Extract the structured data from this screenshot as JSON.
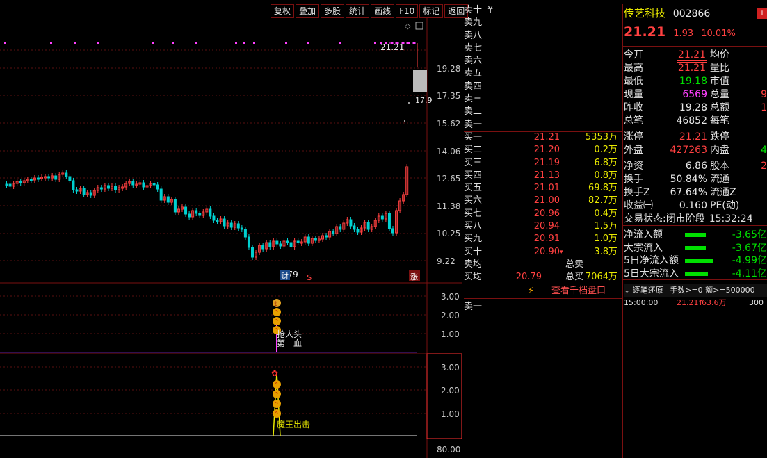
{
  "toolbar": [
    "复权",
    "叠加",
    "多股",
    "统计",
    "画线",
    "F10",
    "标记",
    "返回"
  ],
  "main_chart": {
    "price_labels": [
      "19.28",
      "17.35",
      "15.62",
      "14.06",
      "12.65",
      "11.38",
      "10.25",
      "9.22"
    ],
    "last_price_tag": "21.21",
    "cut_label": "17.9",
    "low_label": "8.79",
    "cai_badge": "财",
    "dollar_badge": "$",
    "zhang_badge": "涨"
  },
  "ind1": {
    "scale": [
      "3.00",
      "2.00",
      "1.00"
    ],
    "text1": "抢人头",
    "text2": "第一血"
  },
  "ind2": {
    "scale": [
      "3.00",
      "2.00",
      "1.00"
    ],
    "text1": "魔王出击",
    "bottom_label": "80.00"
  },
  "orderbook": {
    "sell": [
      {
        "label": "卖十",
        "price": "",
        "vol": "",
        "extra": "¥"
      },
      {
        "label": "卖九",
        "price": "",
        "vol": ""
      },
      {
        "label": "卖八",
        "price": "",
        "vol": ""
      },
      {
        "label": "卖七",
        "price": "",
        "vol": ""
      },
      {
        "label": "卖六",
        "price": "",
        "vol": ""
      },
      {
        "label": "卖五",
        "price": "",
        "vol": ""
      },
      {
        "label": "卖四",
        "price": "",
        "vol": ""
      },
      {
        "label": "卖三",
        "price": "",
        "vol": ""
      },
      {
        "label": "卖二",
        "price": "",
        "vol": ""
      },
      {
        "label": "卖一",
        "price": "",
        "vol": ""
      }
    ],
    "buy": [
      {
        "label": "买一",
        "price": "21.21",
        "vol": "5353万"
      },
      {
        "label": "买二",
        "price": "21.20",
        "vol": "0.2万"
      },
      {
        "label": "买三",
        "price": "21.19",
        "vol": "6.8万"
      },
      {
        "label": "买四",
        "price": "21.13",
        "vol": "0.8万"
      },
      {
        "label": "买五",
        "price": "21.01",
        "vol": "69.8万"
      },
      {
        "label": "买六",
        "price": "21.00",
        "vol": "82.7万"
      },
      {
        "label": "买七",
        "price": "20.96",
        "vol": "0.4万"
      },
      {
        "label": "买八",
        "price": "20.94",
        "vol": "1.5万"
      },
      {
        "label": "买九",
        "price": "20.91",
        "vol": "1.0万"
      },
      {
        "label": "买十",
        "price": "20.90",
        "vol": "3.8万",
        "arrow": "▾"
      }
    ],
    "avg_sell_label": "卖均",
    "total_sell_label": "总卖",
    "avg_buy_label": "买均",
    "avg_buy_price": "20.79",
    "total_buy_label": "总买",
    "total_buy_vol": "7064万",
    "view_more": "查看千档盘口",
    "sell1_bottom": "卖一"
  },
  "quote": {
    "name": "传艺科技",
    "code": "002866",
    "price": "21.21",
    "change": "1.93",
    "pct": "10.01%",
    "rows1": [
      {
        "l": "今开",
        "v": "21.21",
        "vc": "#ff4040",
        "box": true,
        "l2": "均价",
        "v2": ""
      },
      {
        "l": "最高",
        "v": "21.21",
        "vc": "#ff4040",
        "box": true,
        "l2": "量比",
        "v2": ""
      },
      {
        "l": "最低",
        "v": "19.18",
        "vc": "#00e000",
        "box": false,
        "l2": "市值",
        "v2": ""
      },
      {
        "l": "现量",
        "v": "6569",
        "vc": "#ff40ff",
        "box": false,
        "l2": "总量",
        "v2": "9"
      },
      {
        "l": "昨收",
        "v": "19.28",
        "vc": "#e8e8e8",
        "box": false,
        "l2": "总额",
        "v2": "1"
      },
      {
        "l": "总笔",
        "v": "46852",
        "vc": "#e8e8e8",
        "box": false,
        "l2": "每笔",
        "v2": ""
      }
    ],
    "rows2": [
      {
        "l": "涨停",
        "v": "21.21",
        "vc": "#ff4040",
        "l2": "跌停",
        "v2": ""
      },
      {
        "l": "外盘",
        "v": "427263",
        "vc": "#ff4040",
        "l2": "内盘",
        "v2": "4",
        "v2c": "#00e000"
      }
    ],
    "rows3": [
      {
        "l": "净资",
        "v": "6.86",
        "vc": "#e8e8e8",
        "l2": "股本",
        "v2": "2"
      },
      {
        "l": "换手",
        "v": "50.84%",
        "vc": "#e8e8e8",
        "l2": "流通",
        "v2": ""
      },
      {
        "l": "换手Z",
        "v": "67.64%",
        "vc": "#e8e8e8",
        "l2": "流通Z",
        "v2": ""
      },
      {
        "l": "收益㈠",
        "v": "0.160",
        "vc": "#e8e8e8",
        "l2": "PE(动)",
        "v2": ""
      }
    ],
    "trade_state_label": "交易状态:",
    "trade_state": "闭市阶段",
    "trade_time": "15:32:24",
    "flows": [
      {
        "l": "净流入额",
        "v": "-3.65亿",
        "w": 0.43
      },
      {
        "l": "大宗流入",
        "v": "-3.67亿",
        "w": 0.43
      },
      {
        "l": "5日净流入额",
        "v": "-4.99亿",
        "w": 0.58
      },
      {
        "l": "5日大宗流入",
        "v": "-4.11亿",
        "w": 0.48
      }
    ],
    "tick_header": "逐笔还原",
    "tick_filter": "手数>=0 额>=500000",
    "tick": {
      "time": "15:00:00",
      "price": "21.21",
      "vol": "63.6万",
      "n": "300"
    }
  },
  "colors": {
    "up": "#ff4040",
    "down": "#00d0d0",
    "frame": "#7a1010"
  }
}
